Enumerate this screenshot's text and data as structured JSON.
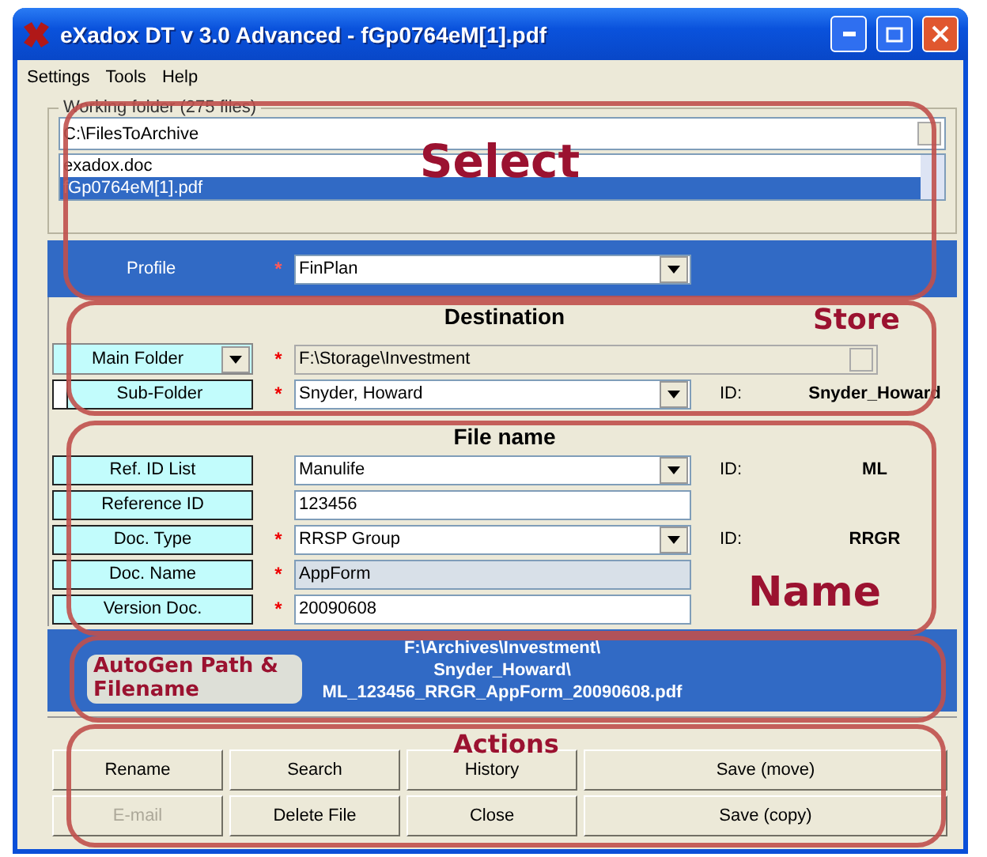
{
  "window": {
    "title": "eXadox DT v 3.0 Advanced - fGp0764eM[1].pdf"
  },
  "menu": [
    {
      "label": "Settings"
    },
    {
      "label": "Tools"
    },
    {
      "label": "Help"
    }
  ],
  "working_folder": {
    "legend": "Working folder (275 files)",
    "path": "C:\\FilesToArchive",
    "files": [
      {
        "name": "exadox.doc",
        "selected": false
      },
      {
        "name": "fGp0764eM[1].pdf",
        "selected": true
      }
    ]
  },
  "profile": {
    "label": "Profile",
    "required_mark": "*",
    "value": "FinPlan"
  },
  "destination": {
    "heading": "Destination",
    "rows": [
      {
        "label": "Main Folder",
        "label_dropdown": true,
        "required_mark": "*",
        "kind": "path",
        "value": "F:\\Storage\\Investment"
      },
      {
        "label": "Sub-Folder",
        "checkbox": {
          "checked": false
        },
        "required_mark": "*",
        "kind": "combo",
        "value": "Snyder, Howard",
        "id_label": "ID:",
        "id_value": "Snyder_Howard"
      }
    ]
  },
  "file_name": {
    "heading": "File name",
    "rows": [
      {
        "label": "Ref. ID List",
        "kind": "combo",
        "value": "Manulife",
        "id_label": "ID:",
        "id_value": "ML"
      },
      {
        "label": "Reference ID",
        "kind": "text",
        "value": "123456"
      },
      {
        "label": "Doc. Type",
        "required_mark": "*",
        "kind": "combo",
        "value": "RRSP Group",
        "id_label": "ID:",
        "id_value": "RRGR"
      },
      {
        "label": "Doc. Name",
        "required_mark": "*",
        "kind": "readonly",
        "value": "AppForm"
      },
      {
        "label": "Version Doc.",
        "required_mark": "*",
        "kind": "text",
        "value": "20090608"
      }
    ]
  },
  "output": {
    "lines": [
      "F:\\Archives\\Investment\\",
      "Snyder_Howard\\",
      "ML_123456_RRGR_AppForm_20090608.pdf"
    ]
  },
  "actions": [
    {
      "label": "Rename",
      "disabled": false
    },
    {
      "label": "Search",
      "disabled": false
    },
    {
      "label": "History",
      "disabled": false
    },
    {
      "label": "Save (move)",
      "disabled": false
    },
    {
      "label": "E-mail",
      "disabled": true
    },
    {
      "label": "Delete File",
      "disabled": false
    },
    {
      "label": "Close",
      "disabled": false
    },
    {
      "label": "Save (copy)",
      "disabled": false
    }
  ],
  "annotations": [
    {
      "label": "Select"
    },
    {
      "label": "Store"
    },
    {
      "label": "Name"
    },
    {
      "label": "AutoGen Path & Filename"
    },
    {
      "label": "Actions"
    }
  ]
}
